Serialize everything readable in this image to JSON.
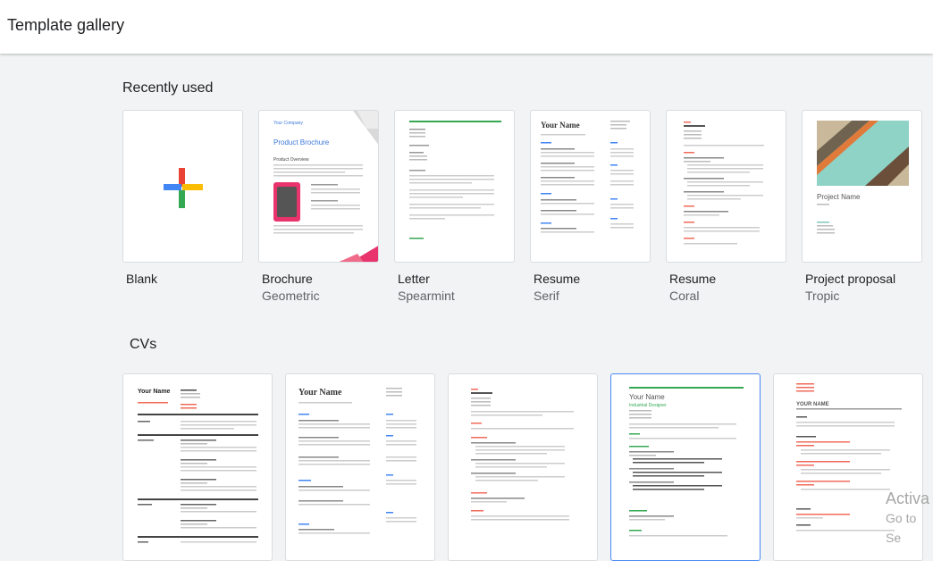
{
  "header": {
    "title": "Template gallery"
  },
  "sections": {
    "recent": "Recently used",
    "cvs": "CVs"
  },
  "recent": [
    {
      "name": "Blank",
      "sub": ""
    },
    {
      "name": "Brochure",
      "sub": "Geometric"
    },
    {
      "name": "Letter",
      "sub": "Spearmint"
    },
    {
      "name": "Resume",
      "sub": "Serif"
    },
    {
      "name": "Resume",
      "sub": "Coral"
    },
    {
      "name": "Project proposal",
      "sub": "Tropic"
    }
  ],
  "thumbs": {
    "brochure_company": "Your Company",
    "brochure_title": "Product Brochure",
    "brochure_section": "Product Overview",
    "resume_name": "Your Name",
    "proposal_title": "Project Name",
    "cv1_name": "Your Name",
    "cv2_name": "Your Name",
    "cv4_name": "Your Name",
    "cv4_role": "Industrial Designer",
    "cv5_name": "YOUR NAME"
  },
  "watermark": {
    "line1": "Activa",
    "line2": "Go to Se"
  },
  "colors": {
    "accent_blue": "#4285f4",
    "accent_red": "#ea4335",
    "accent_yellow": "#fbbc04",
    "accent_green": "#34a853",
    "spearmint": "#34a853",
    "coral": "#f06b5a"
  }
}
